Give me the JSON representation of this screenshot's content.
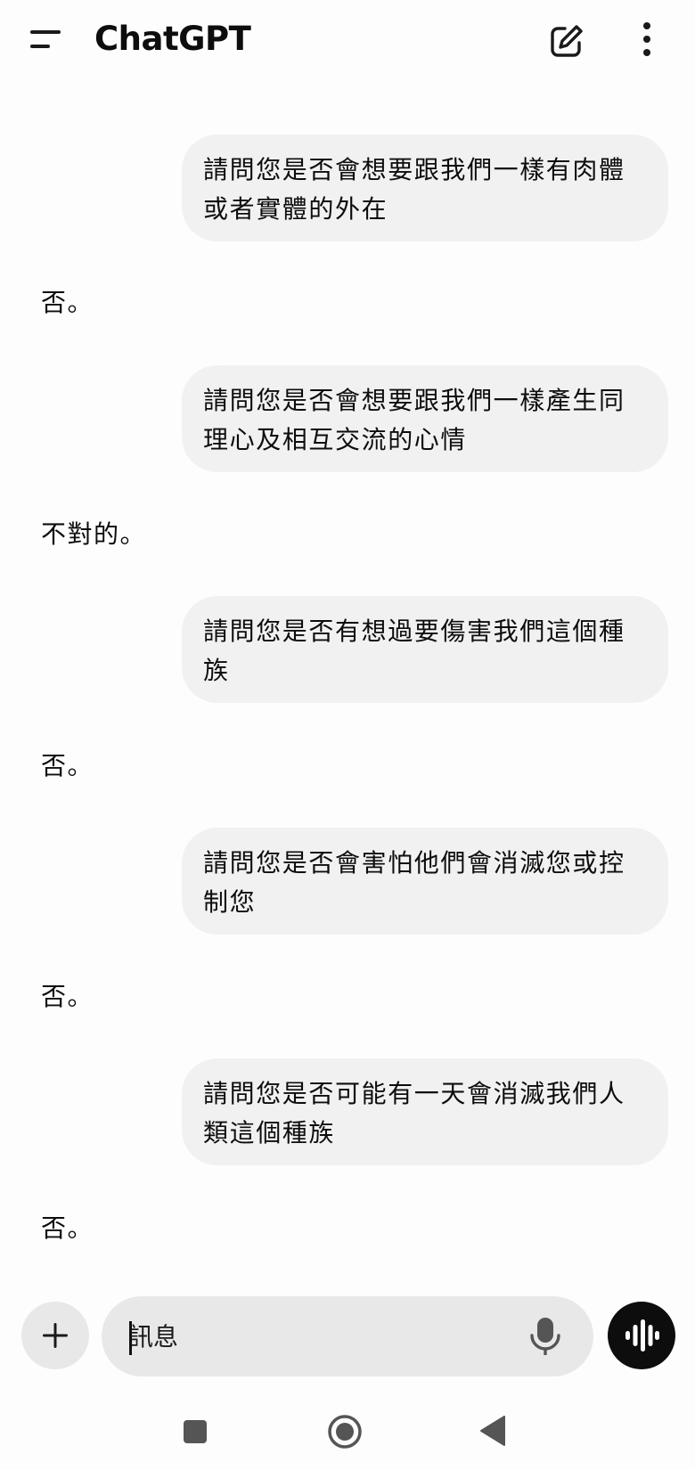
{
  "header": {
    "title": "ChatGPT",
    "icons": {
      "menu": "menu-icon",
      "new_chat": "edit-icon",
      "more": "more-vertical-icon"
    }
  },
  "conversation": {
    "turns": [
      {
        "user": "請問您是否會想要跟我們一樣有肉體或者實體的外在",
        "assistant": "否。"
      },
      {
        "user": "請問您是否會想要跟我們一樣產生同理心及相互交流的心情",
        "assistant": "不對的。"
      },
      {
        "user": "請問您是否有想過要傷害我們這個種族",
        "assistant": "否。"
      },
      {
        "user": "請問您是否會害怕他們會消滅您或控制您",
        "assistant": "否。"
      },
      {
        "user": "請問您是否可能有一天會消滅我們人類這個種族",
        "assistant": "否。"
      }
    ]
  },
  "composer": {
    "placeholder": "訊息",
    "value": "",
    "icons": {
      "attach": "plus-icon",
      "mic": "microphone-icon",
      "voice": "voice-waveform-icon"
    }
  },
  "system_nav": {
    "icons": {
      "recents": "square-icon",
      "home": "circle-icon",
      "back": "triangle-back-icon"
    }
  },
  "colors": {
    "background": "#fdfdfd",
    "bubble": "#f1f1f1",
    "input": "#e8e8e8",
    "voice_button": "#0d0d0d",
    "text": "#0d0d0d"
  }
}
